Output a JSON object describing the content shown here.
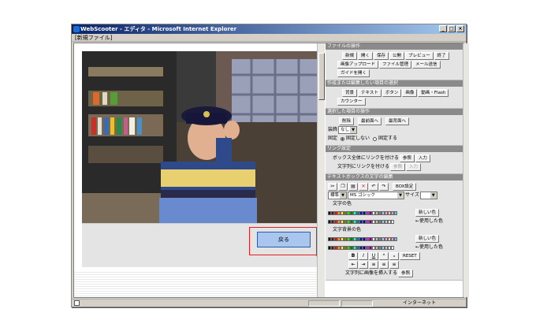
{
  "window": {
    "title": "WebScooter - エディタ - Microsoft Internet Explorer",
    "min": "_",
    "max": "□",
    "close": "×"
  },
  "menubar": {
    "label": "[新規ファイル]"
  },
  "main": {
    "back_label": "戻る"
  },
  "panel": {
    "file_ops": {
      "header": "ファイルの操作",
      "new": "新規",
      "open": "開く",
      "save": "保存",
      "publish": "公開",
      "preview": "プレビュー",
      "end": "終了",
      "upload": "画像アップロード",
      "file_mgmt": "ファイル管理",
      "mail": "メール送信",
      "guide": "ガイドを開く"
    },
    "items": {
      "header": "作成または編集したい項目の選択",
      "bg": "背景",
      "text": "テキスト",
      "button": "ボタン",
      "image": "画像",
      "video": "動画・Flash",
      "counter": "カウンター"
    },
    "selected": {
      "header": "選択した項目の操作",
      "delete": "削除",
      "front": "最前面へ",
      "back": "最背面へ",
      "decor_label": "装飾",
      "decor_value": "なし",
      "fix_label": "固定",
      "not_fixed": "固定しない",
      "fixed": "固定する"
    },
    "link": {
      "header": "リンク設定",
      "box_label": "ボックス全体にリンクを付ける",
      "text_label": "文字列にリンクを付ける",
      "ref": "参照",
      "input": "入力"
    },
    "textedit": {
      "header": "テキストボックスの文字の編集",
      "box_setting": "BOX設定",
      "style": "標準",
      "font": "MS ゴシック",
      "size_label": "サイズ",
      "color_label": "文字の色",
      "bg_color_label": "文字背景の色",
      "new_color": "新しい色",
      "used_color": "←使用した色",
      "reset": "RESET",
      "insert_image_label": "文字列に画像を挿入する",
      "ref": "参照"
    },
    "textedit_icons": [
      "cut-icon",
      "copy-icon",
      "paste-icon",
      "delete-icon",
      "undo-icon",
      "redo-icon"
    ],
    "format_labels": {
      "bold": "B",
      "italic": "I",
      "underline": "U"
    }
  },
  "status": {
    "zone": "インターネット"
  },
  "colors": {
    "palette": [
      "#000000",
      "#800000",
      "#ff0000",
      "#ff9900",
      "#ffff00",
      "#808000",
      "#00ff00",
      "#008000",
      "#00ffff",
      "#008080",
      "#0000ff",
      "#000080",
      "#ff00ff",
      "#800080",
      "#ffffff",
      "#c0c0c0",
      "#808080",
      "#99ccff",
      "#ff99cc",
      "#ffcc99",
      "#cc99ff",
      "#66cccc"
    ],
    "used": [
      "#c8c8c8",
      "#e8e8e8",
      "#ffffff"
    ]
  }
}
